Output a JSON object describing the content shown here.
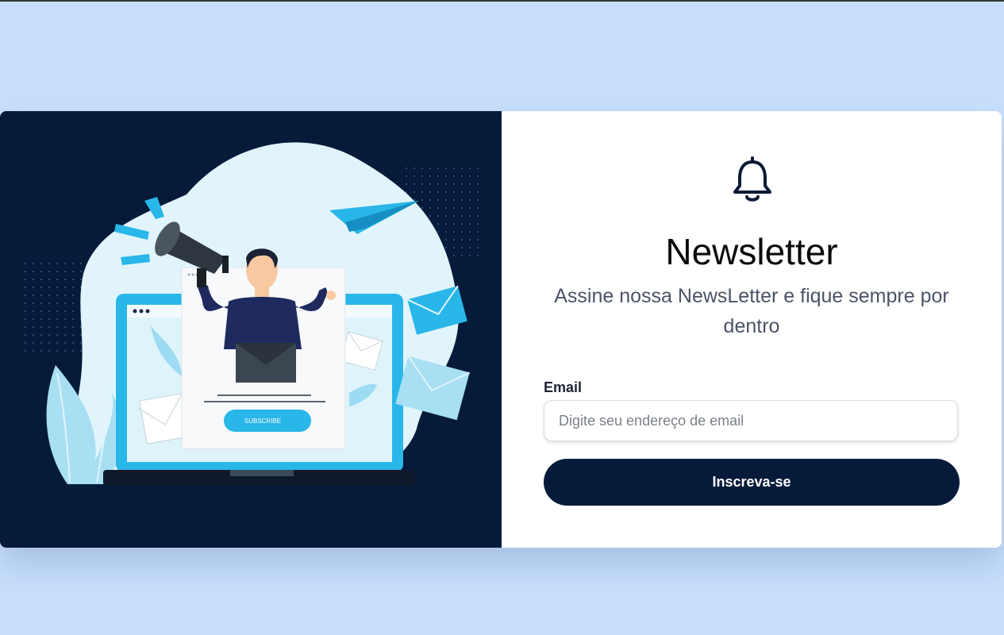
{
  "illustration": {
    "subscribe_button_label": "SUBSCRIBE"
  },
  "newsletter": {
    "icon": "bell-icon",
    "title": "Newsletter",
    "subtitle": "Assine nossa NewsLetter e fique sempre por dentro",
    "email_label": "Email",
    "email_placeholder": "Digite seu endereço de email",
    "email_value": "",
    "button_label": "Inscreva-se"
  },
  "colors": {
    "page_background": "#c7dffc",
    "illustration_background": "#061b39",
    "accent_blue": "#29b6e8",
    "button_background": "#061b39"
  }
}
